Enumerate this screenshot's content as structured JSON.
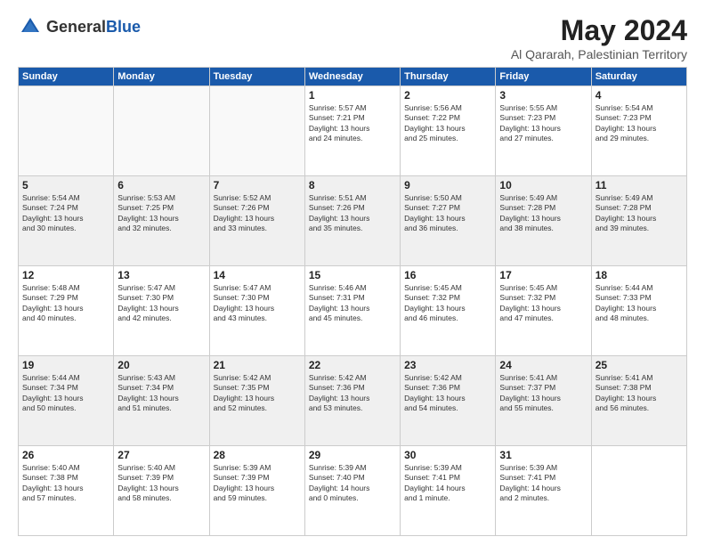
{
  "logo": {
    "general": "General",
    "blue": "Blue"
  },
  "title": "May 2024",
  "subtitle": "Al Qararah, Palestinian Territory",
  "days_header": [
    "Sunday",
    "Monday",
    "Tuesday",
    "Wednesday",
    "Thursday",
    "Friday",
    "Saturday"
  ],
  "weeks": [
    [
      {
        "day": "",
        "info": ""
      },
      {
        "day": "",
        "info": ""
      },
      {
        "day": "",
        "info": ""
      },
      {
        "day": "1",
        "info": "Sunrise: 5:57 AM\nSunset: 7:21 PM\nDaylight: 13 hours\nand 24 minutes."
      },
      {
        "day": "2",
        "info": "Sunrise: 5:56 AM\nSunset: 7:22 PM\nDaylight: 13 hours\nand 25 minutes."
      },
      {
        "day": "3",
        "info": "Sunrise: 5:55 AM\nSunset: 7:23 PM\nDaylight: 13 hours\nand 27 minutes."
      },
      {
        "day": "4",
        "info": "Sunrise: 5:54 AM\nSunset: 7:23 PM\nDaylight: 13 hours\nand 29 minutes."
      }
    ],
    [
      {
        "day": "5",
        "info": "Sunrise: 5:54 AM\nSunset: 7:24 PM\nDaylight: 13 hours\nand 30 minutes."
      },
      {
        "day": "6",
        "info": "Sunrise: 5:53 AM\nSunset: 7:25 PM\nDaylight: 13 hours\nand 32 minutes."
      },
      {
        "day": "7",
        "info": "Sunrise: 5:52 AM\nSunset: 7:26 PM\nDaylight: 13 hours\nand 33 minutes."
      },
      {
        "day": "8",
        "info": "Sunrise: 5:51 AM\nSunset: 7:26 PM\nDaylight: 13 hours\nand 35 minutes."
      },
      {
        "day": "9",
        "info": "Sunrise: 5:50 AM\nSunset: 7:27 PM\nDaylight: 13 hours\nand 36 minutes."
      },
      {
        "day": "10",
        "info": "Sunrise: 5:49 AM\nSunset: 7:28 PM\nDaylight: 13 hours\nand 38 minutes."
      },
      {
        "day": "11",
        "info": "Sunrise: 5:49 AM\nSunset: 7:28 PM\nDaylight: 13 hours\nand 39 minutes."
      }
    ],
    [
      {
        "day": "12",
        "info": "Sunrise: 5:48 AM\nSunset: 7:29 PM\nDaylight: 13 hours\nand 40 minutes."
      },
      {
        "day": "13",
        "info": "Sunrise: 5:47 AM\nSunset: 7:30 PM\nDaylight: 13 hours\nand 42 minutes."
      },
      {
        "day": "14",
        "info": "Sunrise: 5:47 AM\nSunset: 7:30 PM\nDaylight: 13 hours\nand 43 minutes."
      },
      {
        "day": "15",
        "info": "Sunrise: 5:46 AM\nSunset: 7:31 PM\nDaylight: 13 hours\nand 45 minutes."
      },
      {
        "day": "16",
        "info": "Sunrise: 5:45 AM\nSunset: 7:32 PM\nDaylight: 13 hours\nand 46 minutes."
      },
      {
        "day": "17",
        "info": "Sunrise: 5:45 AM\nSunset: 7:32 PM\nDaylight: 13 hours\nand 47 minutes."
      },
      {
        "day": "18",
        "info": "Sunrise: 5:44 AM\nSunset: 7:33 PM\nDaylight: 13 hours\nand 48 minutes."
      }
    ],
    [
      {
        "day": "19",
        "info": "Sunrise: 5:44 AM\nSunset: 7:34 PM\nDaylight: 13 hours\nand 50 minutes."
      },
      {
        "day": "20",
        "info": "Sunrise: 5:43 AM\nSunset: 7:34 PM\nDaylight: 13 hours\nand 51 minutes."
      },
      {
        "day": "21",
        "info": "Sunrise: 5:42 AM\nSunset: 7:35 PM\nDaylight: 13 hours\nand 52 minutes."
      },
      {
        "day": "22",
        "info": "Sunrise: 5:42 AM\nSunset: 7:36 PM\nDaylight: 13 hours\nand 53 minutes."
      },
      {
        "day": "23",
        "info": "Sunrise: 5:42 AM\nSunset: 7:36 PM\nDaylight: 13 hours\nand 54 minutes."
      },
      {
        "day": "24",
        "info": "Sunrise: 5:41 AM\nSunset: 7:37 PM\nDaylight: 13 hours\nand 55 minutes."
      },
      {
        "day": "25",
        "info": "Sunrise: 5:41 AM\nSunset: 7:38 PM\nDaylight: 13 hours\nand 56 minutes."
      }
    ],
    [
      {
        "day": "26",
        "info": "Sunrise: 5:40 AM\nSunset: 7:38 PM\nDaylight: 13 hours\nand 57 minutes."
      },
      {
        "day": "27",
        "info": "Sunrise: 5:40 AM\nSunset: 7:39 PM\nDaylight: 13 hours\nand 58 minutes."
      },
      {
        "day": "28",
        "info": "Sunrise: 5:39 AM\nSunset: 7:39 PM\nDaylight: 13 hours\nand 59 minutes."
      },
      {
        "day": "29",
        "info": "Sunrise: 5:39 AM\nSunset: 7:40 PM\nDaylight: 14 hours\nand 0 minutes."
      },
      {
        "day": "30",
        "info": "Sunrise: 5:39 AM\nSunset: 7:41 PM\nDaylight: 14 hours\nand 1 minute."
      },
      {
        "day": "31",
        "info": "Sunrise: 5:39 AM\nSunset: 7:41 PM\nDaylight: 14 hours\nand 2 minutes."
      },
      {
        "day": "",
        "info": ""
      }
    ]
  ]
}
